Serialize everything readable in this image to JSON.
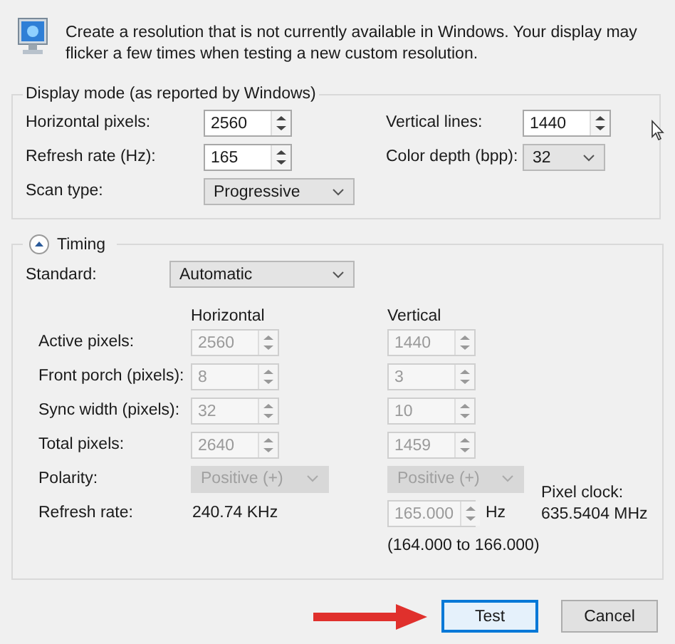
{
  "description": "Create a resolution that is not currently available in Windows. Your display may flicker a few times when testing a new custom resolution.",
  "display_mode": {
    "title": "Display mode (as reported by Windows)",
    "fields": [
      {
        "label": "Horizontal pixels:",
        "kind": "spin",
        "value": "2560",
        "disabled": false
      },
      {
        "label": "Vertical lines:",
        "kind": "spin",
        "value": "1440",
        "disabled": false
      },
      {
        "label": "Refresh rate (Hz):",
        "kind": "spin",
        "value": "165",
        "disabled": false
      },
      {
        "label": "Color depth (bpp):",
        "kind": "dropdown",
        "value": "32",
        "disabled": false
      },
      {
        "label": "Scan type:",
        "kind": "dropdown",
        "value": "Progressive",
        "disabled": false
      }
    ]
  },
  "timing": {
    "title": "Timing",
    "expanded": true,
    "standard": {
      "label": "Standard:",
      "value": "Automatic",
      "disabled": false
    },
    "columns": [
      "Horizontal",
      "Vertical"
    ],
    "rows": [
      {
        "label": "Active pixels:",
        "horizontal": {
          "kind": "spin",
          "value": "2560",
          "disabled": true
        },
        "vertical": {
          "kind": "spin",
          "value": "1440",
          "disabled": true
        }
      },
      {
        "label": "Front porch (pixels):",
        "horizontal": {
          "kind": "spin",
          "value": "8",
          "disabled": true
        },
        "vertical": {
          "kind": "spin",
          "value": "3",
          "disabled": true
        }
      },
      {
        "label": "Sync width (pixels):",
        "horizontal": {
          "kind": "spin",
          "value": "32",
          "disabled": true
        },
        "vertical": {
          "kind": "spin",
          "value": "10",
          "disabled": true
        }
      },
      {
        "label": "Total pixels:",
        "horizontal": {
          "kind": "spin",
          "value": "2640",
          "disabled": true
        },
        "vertical": {
          "kind": "spin",
          "value": "1459",
          "disabled": true
        }
      },
      {
        "label": "Polarity:",
        "horizontal": {
          "kind": "dropdown",
          "value": "Positive (+)",
          "disabled": true
        },
        "vertical": {
          "kind": "dropdown",
          "value": "Positive (+)",
          "disabled": true
        }
      },
      {
        "label": "Refresh rate:",
        "horizontal": {
          "kind": "text",
          "value": "240.74 KHz"
        },
        "vertical": {
          "kind": "spin",
          "value": "165.000",
          "disabled": true,
          "unit": "Hz",
          "note": "(164.000 to 166.000)"
        }
      }
    ],
    "pixel_clock": {
      "label": "Pixel clock:",
      "value": "635.5404 MHz"
    }
  },
  "buttons": [
    {
      "label": "Test",
      "default": true
    },
    {
      "label": "Cancel",
      "default": false
    }
  ]
}
